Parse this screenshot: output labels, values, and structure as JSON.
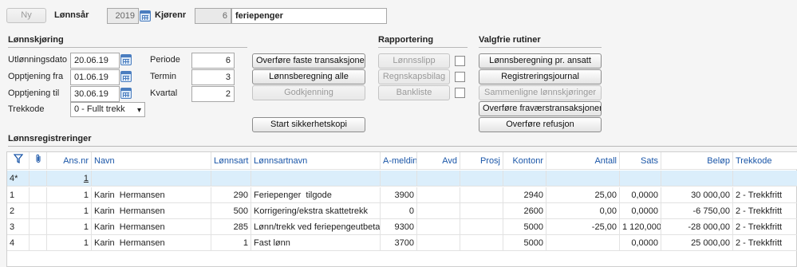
{
  "toolbar": {
    "new_label": "Ny"
  },
  "header": {
    "lonnsar_label": "Lønnsår",
    "lonnsar_value": "2019",
    "kjorenr_label": "Kjørenr",
    "kjorenr_number": "6",
    "kjorenr_name": "feriepenger"
  },
  "lonnskjoring": {
    "title": "Lønnskjøring",
    "utlonningsdato_label": "Utlønningsdato",
    "utlonningsdato_value": "20.06.19",
    "opptjening_fra_label": "Opptjening fra",
    "opptjening_fra_value": "01.06.19",
    "opptjening_til_label": "Opptjening til",
    "opptjening_til_value": "30.06.19",
    "trekkode_label": "Trekkode",
    "trekkode_value": "0 - Fullt trekk",
    "periode_label": "Periode",
    "periode_value": "6",
    "termin_label": "Termin",
    "termin_value": "3",
    "kvartal_label": "Kvartal",
    "kvartal_value": "2"
  },
  "actions": {
    "overfore_faste": "Overføre faste transaksjoner",
    "lonnsberegning_alle": "Lønnsberegning alle",
    "godkjenning": "Godkjenning",
    "start_sikkerhetskopi": "Start sikkerhetskopi"
  },
  "rapportering": {
    "title": "Rapportering",
    "lonnsslipp": "Lønnsslipp",
    "regnskapsbilag": "Regnskapsbilag",
    "bankliste": "Bankliste"
  },
  "valgfrie": {
    "title": "Valgfrie rutiner",
    "lonnsberegning_ansatt": "Lønnsberegning pr. ansatt",
    "registreringsjournal": "Registreringsjournal",
    "sammenligne": "Sammenligne lønnskjøringer",
    "overfore_fravaer": "Overføre fraværstransaksjoner",
    "overfore_refusjon": "Overføre refusjon"
  },
  "registreringer": {
    "title": "Lønnsregistreringer",
    "columns": [
      "Ans.nr",
      "Navn",
      "Lønnsart",
      "Lønnsartnavn",
      "A-meldin",
      "Avd",
      "Prosj",
      "Kontonr",
      "Antall",
      "Sats",
      "Beløp",
      "Trekkode"
    ],
    "new_row": {
      "rownum": "4*",
      "ansnr": "1"
    },
    "rows": [
      {
        "rownum": "1",
        "ansnr": "1",
        "navn": "Karin  Hermansen",
        "lonnsart": "290",
        "lonnsartnavn": "Feriepenger  tilgode",
        "amelding": "3900",
        "avd": "",
        "prosj": "",
        "kontonr": "2940",
        "antall": "25,00",
        "sats": "0,0000",
        "belop": "30 000,00",
        "trekkode": "2 - Trekkfritt"
      },
      {
        "rownum": "2",
        "ansnr": "1",
        "navn": "Karin  Hermansen",
        "lonnsart": "500",
        "lonnsartnavn": "Korrigering/ekstra skattetrekk",
        "amelding": "0",
        "avd": "",
        "prosj": "",
        "kontonr": "2600",
        "antall": "0,00",
        "sats": "0,0000",
        "belop": "-6 750,00",
        "trekkode": "2 - Trekkfritt"
      },
      {
        "rownum": "3",
        "ansnr": "1",
        "navn": "Karin  Hermansen",
        "lonnsart": "285",
        "lonnsartnavn": "Lønn/trekk ved feriepengeutbetaling",
        "amelding": "9300",
        "avd": "",
        "prosj": "",
        "kontonr": "5000",
        "antall": "-25,00",
        "sats": "1 120,0000",
        "belop": "-28 000,00",
        "trekkode": "2 - Trekkfritt"
      },
      {
        "rownum": "4",
        "ansnr": "1",
        "navn": "Karin  Hermansen",
        "lonnsart": "1",
        "lonnsartnavn": "Fast lønn",
        "amelding": "3700",
        "avd": "",
        "prosj": "",
        "kontonr": "5000",
        "antall": "",
        "sats": "0,0000",
        "belop": "25 000,00",
        "trekkode": "2 - Trekkfritt"
      }
    ]
  },
  "icons": {
    "filter": "filter-icon",
    "attachment": "paperclip-icon",
    "calendar": "calendar-icon"
  },
  "colors": {
    "header_text": "#1a56a8",
    "new_row_bg": "#dbeefb"
  }
}
